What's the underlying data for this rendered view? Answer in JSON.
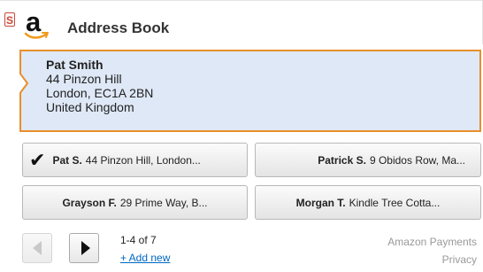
{
  "header": {
    "badge": "S",
    "title": "Address Book"
  },
  "selected_address": {
    "name": "Pat Smith",
    "line1": "44 Pinzon Hill",
    "line2": "London, EC1A 2BN",
    "line3": "United Kingdom"
  },
  "address_buttons": [
    {
      "name": "Pat S.",
      "detail": "44 Pinzon Hill, London..."
    },
    {
      "name": "Patrick S.",
      "detail": "9 Obidos Row, Ma..."
    },
    {
      "name": "Grayson F.",
      "detail": "29 Prime Way, B..."
    },
    {
      "name": "Morgan T.",
      "detail": "Kindle Tree Cotta..."
    }
  ],
  "pagination": {
    "count_text": "1-4 of 7",
    "add_new_label": "+ Add new"
  },
  "footer": {
    "payments_label": "Amazon Payments",
    "privacy_label": "Privacy"
  },
  "icons": {
    "logo": "amazon-logo",
    "selected_check": "checkmark-icon",
    "previous": "chevron-left-icon",
    "next": "chevron-right-icon"
  },
  "colors": {
    "accent_orange": "#e7902b",
    "selected_background": "#dfe8f6",
    "link_blue": "#0066c0",
    "badge_red": "#c74b3c"
  }
}
